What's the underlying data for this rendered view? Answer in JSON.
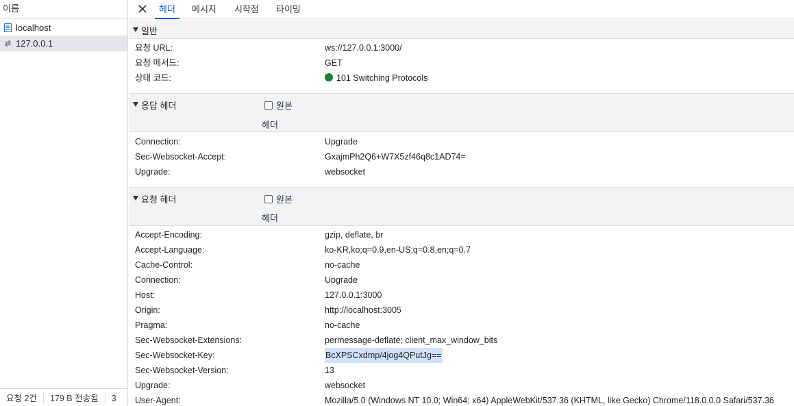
{
  "left_pane": {
    "column_header": "이름",
    "requests": [
      {
        "name": "localhost",
        "icon": "document-icon"
      },
      {
        "name": "127.0.0.1",
        "icon": "websocket-arrows-icon"
      }
    ],
    "status": {
      "requests": "요청 2건",
      "transferred": "179 B 전송됨",
      "more": "3"
    }
  },
  "tabs": [
    "헤더",
    "메시지",
    "시작점",
    "타이밍"
  ],
  "general": {
    "title": "일반",
    "rows": [
      {
        "key": "요청 URL:",
        "value": "ws://127.0.0.1:3000/"
      },
      {
        "key": "요청 메서드:",
        "value": "GET"
      },
      {
        "key": "상태 코드:",
        "value": "101 Switching Protocols"
      }
    ]
  },
  "response_headers": {
    "title": "응답 헤더",
    "raw_label": "원본",
    "sub_label": "헤더",
    "rows": [
      {
        "key": "Connection:",
        "value": "Upgrade"
      },
      {
        "key": "Sec-Websocket-Accept:",
        "value": "GxajmPh2Q6+W7X5zf46q8c1AD74="
      },
      {
        "key": "Upgrade:",
        "value": "websocket"
      }
    ]
  },
  "request_headers": {
    "title": "요청 헤더",
    "raw_label": "원본",
    "sub_label": "헤더",
    "rows": [
      {
        "key": "Accept-Encoding:",
        "value": "gzip, deflate, br"
      },
      {
        "key": "Accept-Language:",
        "value": "ko-KR,ko;q=0.9,en-US;q=0.8,en;q=0.7"
      },
      {
        "key": "Cache-Control:",
        "value": "no-cache"
      },
      {
        "key": "Connection:",
        "value": "Upgrade"
      },
      {
        "key": "Host:",
        "value": "127.0.0.1:3000"
      },
      {
        "key": "Origin:",
        "value": "http://localhost:3005"
      },
      {
        "key": "Pragma:",
        "value": "no-cache"
      },
      {
        "key": "Sec-Websocket-Extensions:",
        "value": "permessage-deflate; client_max_window_bits"
      },
      {
        "key": "Sec-Websocket-Key:",
        "value": "BcXPSCxdmp/4jog4QPutJg=="
      },
      {
        "key": "Sec-Websocket-Version:",
        "value": "13"
      },
      {
        "key": "Upgrade:",
        "value": "websocket"
      },
      {
        "key": "User-Agent:",
        "value": "Mozilla/5.0 (Windows NT 10.0; Win64; x64) AppleWebKit/537.36 (KHTML, like Gecko) Chrome/118.0.0.0 Safari/537.36"
      }
    ]
  },
  "colors": {
    "accent": "#0b57d0",
    "status_ok": "#188038",
    "selection": "#cfe2fc"
  }
}
